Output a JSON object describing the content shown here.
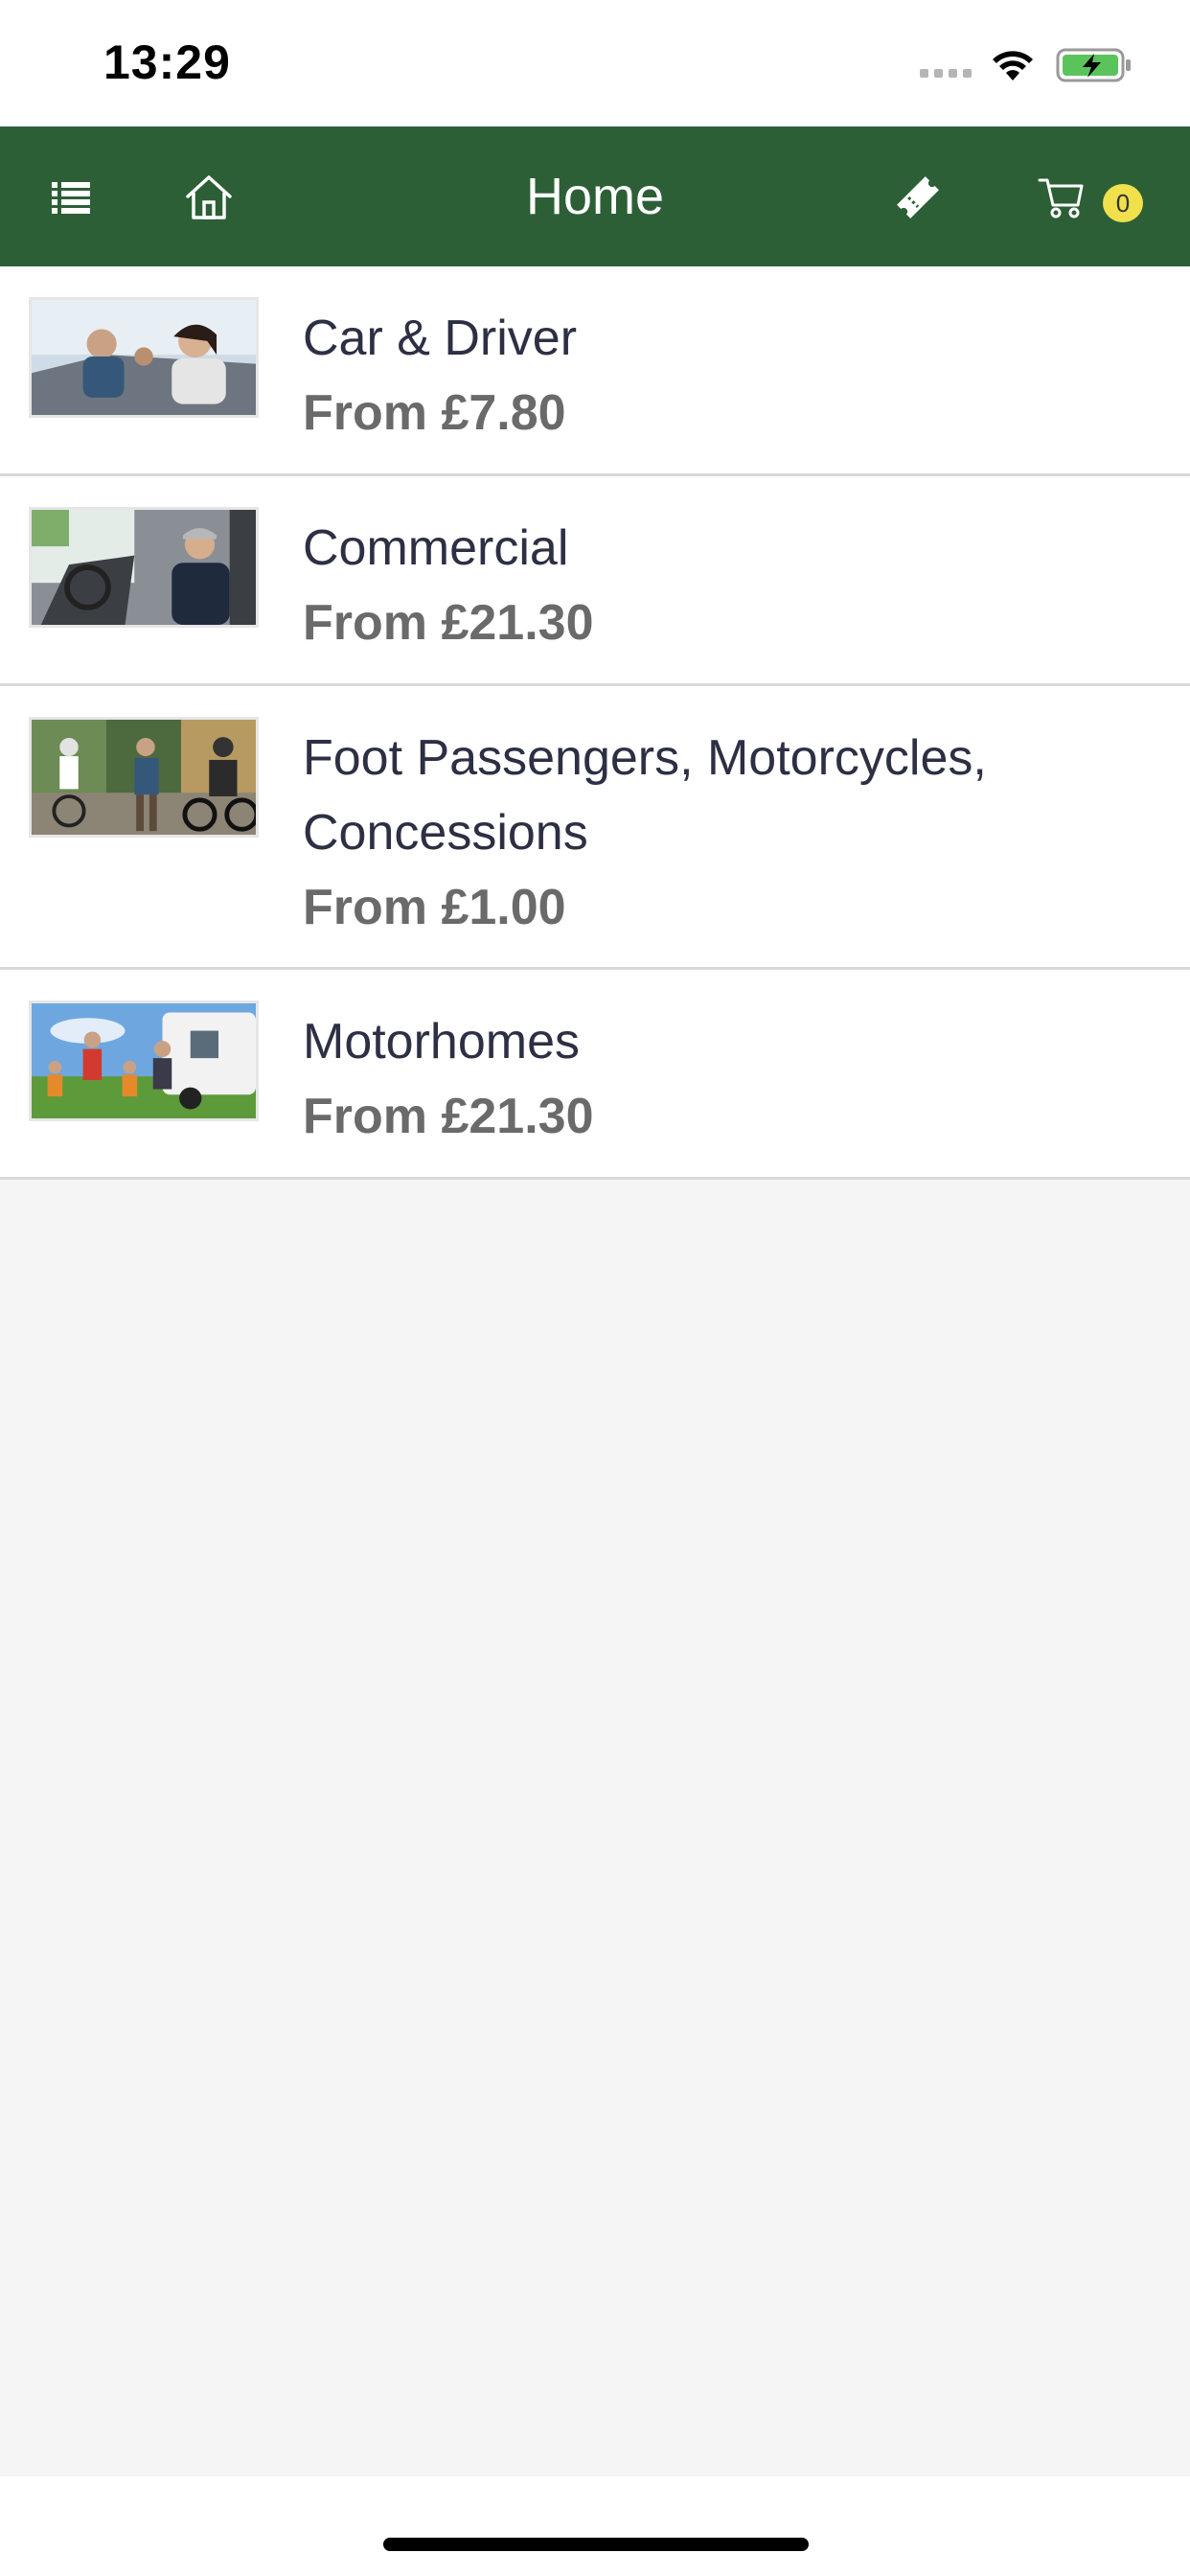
{
  "status_bar": {
    "time": "13:29",
    "icons": [
      "cellular-signal-icon",
      "wifi-icon",
      "battery-charging-icon"
    ]
  },
  "header": {
    "title": "Home",
    "background_color": "#2d5f37",
    "left_icons": [
      "list-menu-icon",
      "home-icon"
    ],
    "right_icons": [
      "ticket-icon",
      "cart-icon"
    ],
    "cart_count": "0",
    "badge_color": "#f0e04b"
  },
  "products": [
    {
      "title": "Car & Driver",
      "price": "From £7.80",
      "image": "car-and-driver-photo"
    },
    {
      "title": "Commercial",
      "price": "From £21.30",
      "image": "commercial-van-photo"
    },
    {
      "title": "Foot Passengers, Motorcycles, Concessions",
      "price": "From £1.00",
      "image": "foot-passengers-photo"
    },
    {
      "title": "Motorhomes",
      "price": "From £21.30",
      "image": "motorhomes-photo"
    }
  ]
}
